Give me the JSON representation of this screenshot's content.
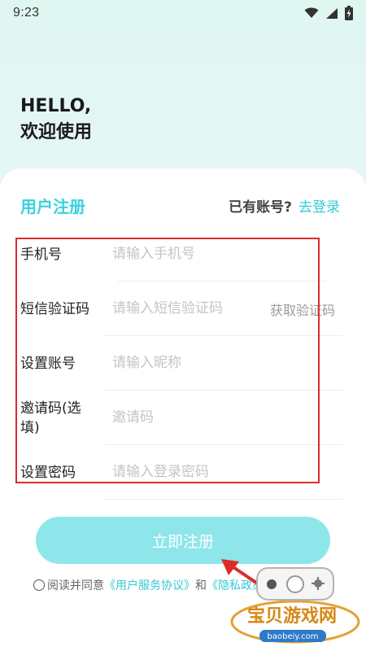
{
  "status_bar": {
    "time": "9:23",
    "icons": [
      "wifi-icon",
      "cellular-signal-icon",
      "battery-charging-icon"
    ]
  },
  "header": {
    "greeting_line1": "HELLO,",
    "greeting_line2": "欢迎使用"
  },
  "register_card": {
    "title": "用户注册",
    "have_account": "已有账号?",
    "login_link": "去登录"
  },
  "form": {
    "fields": [
      {
        "label": "手机号",
        "placeholder": "请输入手机号"
      },
      {
        "label": "短信验证码",
        "placeholder": "请输入短信验证码",
        "action": "获取验证码"
      },
      {
        "label": "设置账号",
        "placeholder": "请输入昵称"
      },
      {
        "label_line1": "邀请码(选",
        "label_line2": "填)",
        "placeholder": "邀请码"
      },
      {
        "label": "设置密码",
        "placeholder": "请输入登录密码"
      }
    ],
    "submit": "立即注册"
  },
  "agreement": {
    "prefix": "阅读并同意",
    "link1": "《用户服务协议》",
    "middle": "和",
    "link2": "《隐私政策》"
  },
  "watermark": {
    "title": "宝贝游戏网",
    "url": "baobeiy.com"
  },
  "colors": {
    "accent": "#35d3dc",
    "submit": "#8fe6ea",
    "annotation_red": "#e02a2a"
  }
}
